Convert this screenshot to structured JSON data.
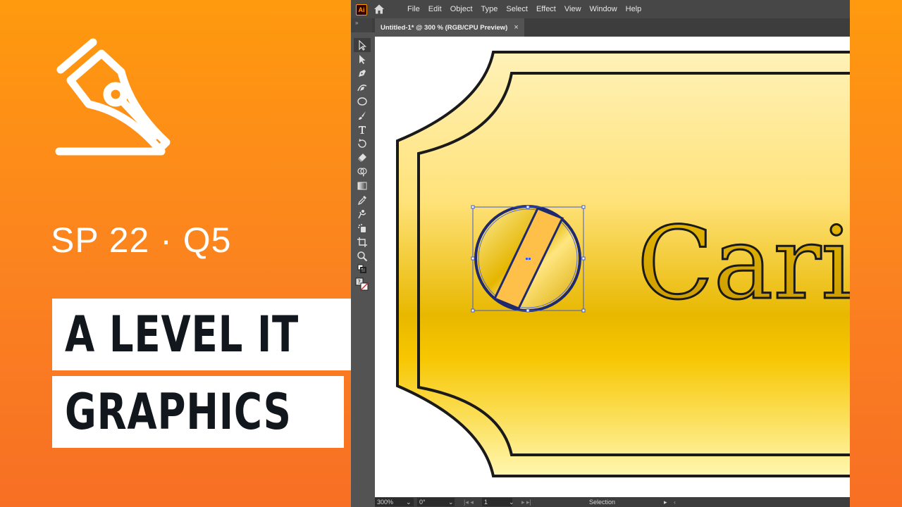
{
  "thumbnail": {
    "subtitle": "SP 22 · Q5",
    "title_line_1": "A LEVEL IT",
    "title_line_2": "GRAPHICS",
    "logo_icon": "pen-nib-icon",
    "colors": {
      "orange_top": "#ff9a0e",
      "orange_bottom": "#f76f24",
      "title_text": "#12161d"
    }
  },
  "app": {
    "badge": "Ai",
    "menu": [
      "File",
      "Edit",
      "Object",
      "Type",
      "Select",
      "Effect",
      "View",
      "Window",
      "Help"
    ],
    "tools_header": "»",
    "document_tab": {
      "label": "Untitled-1* @ 300 % (RGB/CPU Preview)",
      "close": "×"
    },
    "tools": [
      "selection-tool-icon",
      "direct-selection-tool-icon",
      "pen-tool-icon",
      "curvature-tool-icon",
      "ellipse-tool-icon",
      "paintbrush-tool-icon",
      "type-tool-icon",
      "rotate-tool-icon",
      "eraser-tool-icon",
      "shape-builder-tool-icon",
      "gradient-tool-icon",
      "eyedropper-tool-icon",
      "puppet-warp-tool-icon",
      "symbol-sprayer-tool-icon",
      "artboard-tool-icon",
      "zoom-tool-icon"
    ],
    "status": {
      "zoom": "300%",
      "rotation": "0°",
      "artboard": "1",
      "tool": "Selection"
    }
  },
  "artwork": {
    "text": "Cari",
    "colors": {
      "gold_light": "#fff2b8",
      "gold_mid": "#ffd84a",
      "gold_dark": "#f5c000",
      "text_fill": "#d9a800",
      "outline": "#1a1a1a",
      "selection": "#3b5bdb"
    }
  }
}
